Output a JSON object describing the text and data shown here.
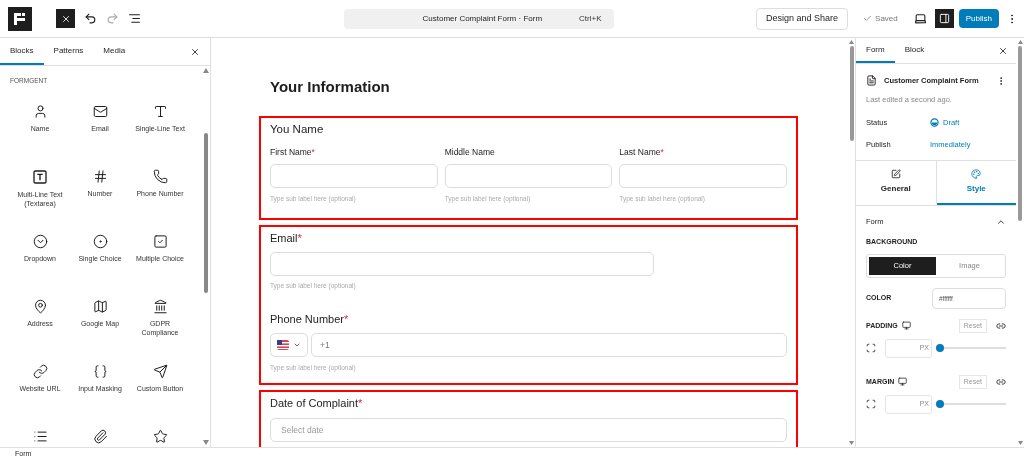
{
  "top_bar": {
    "command_title": "Customer Complaint Form · Form",
    "shortcut": "Ctrl+K",
    "design_button": "Design and Share",
    "saved_status": "Saved",
    "settings_panel_open": true,
    "publish_button": "Publish"
  },
  "inserter": {
    "tabs": [
      {
        "label": "Blocks",
        "selected": true
      },
      {
        "label": "Patterns",
        "selected": false
      },
      {
        "label": "Media",
        "selected": false
      }
    ],
    "category": "FORMGENT",
    "blocks": [
      {
        "kind": "block",
        "label": "Name"
      },
      {
        "kind": "block",
        "label": "Email"
      },
      {
        "kind": "block",
        "label": "Single-Line Text"
      },
      {
        "kind": "block",
        "label": "Multi-Line Text (Textarea)"
      },
      {
        "kind": "block",
        "label": "Number"
      },
      {
        "kind": "block",
        "label": "Phone Number"
      },
      {
        "kind": "block",
        "label": "Dropdown"
      },
      {
        "kind": "block",
        "label": "Single Choice"
      },
      {
        "kind": "block",
        "label": "Multiple Choice"
      },
      {
        "kind": "block",
        "label": "Address"
      },
      {
        "kind": "block",
        "label": "Google Map"
      },
      {
        "kind": "block",
        "label": "GDPR Compliance"
      },
      {
        "kind": "block",
        "label": "Website URL"
      },
      {
        "kind": "block",
        "label": "Input Masking"
      },
      {
        "kind": "block",
        "label": "Custom Button"
      },
      {
        "kind": "icon_only"
      },
      {
        "kind": "icon_only"
      },
      {
        "kind": "icon_only"
      }
    ]
  },
  "canvas": {
    "heading": "Your Information",
    "groups": [
      {
        "highlighted": true,
        "fields": [
          {
            "kind": "name",
            "label": "You Name",
            "parts": [
              {
                "label": "First Name",
                "required_mark": "*",
                "sub_label": "Type sub label here (optional)"
              },
              {
                "label": "Middle Name",
                "sub_label": "Type sub label here (optional)"
              },
              {
                "label": "Last Name",
                "required_mark": "*",
                "sub_label": "Type sub label here (optional)"
              }
            ]
          }
        ]
      },
      {
        "highlighted": true,
        "fields": [
          {
            "kind": "text",
            "label": "Email",
            "required_mark": "*",
            "sub_label": "Type sub label here (optional)"
          },
          {
            "kind": "phone",
            "label": "Phone Number",
            "required_mark": "*",
            "value": "+1",
            "sub_label": "Type sub label here (optional)"
          }
        ]
      },
      {
        "highlighted": true,
        "fields": [
          {
            "kind": "date",
            "label": "Date of Complaint",
            "required_mark": "*",
            "placeholder": "Select date"
          }
        ]
      }
    ]
  },
  "settings": {
    "tabs": [
      {
        "label": "Form",
        "selected": true
      },
      {
        "label": "Block",
        "selected": false
      }
    ],
    "form_title": "Customer Complaint Form",
    "last_edited": "Last edited a second ago.",
    "rows": [
      {
        "label": "Status",
        "value": "Draft"
      },
      {
        "label": "Publish",
        "value": "Immediately"
      }
    ],
    "sub_tabs": [
      {
        "label": "General",
        "selected": false
      },
      {
        "label": "Style",
        "selected": true
      }
    ],
    "section": {
      "title": "Form",
      "expanded": true
    },
    "background_label": "BACKGROUND",
    "background_options": [
      {
        "label": "Color",
        "selected": true
      },
      {
        "label": "Image",
        "selected": false
      }
    ],
    "color_label": "COLOR",
    "color_value": "#ffffff",
    "spacing": [
      {
        "label": "PADDING",
        "reset": "Reset",
        "unit": "PX",
        "level": 0
      },
      {
        "label": "MARGIN",
        "reset": "Reset",
        "unit": "PX",
        "level": 0
      }
    ]
  },
  "status_bar": {
    "breadcrumb": "Form"
  }
}
